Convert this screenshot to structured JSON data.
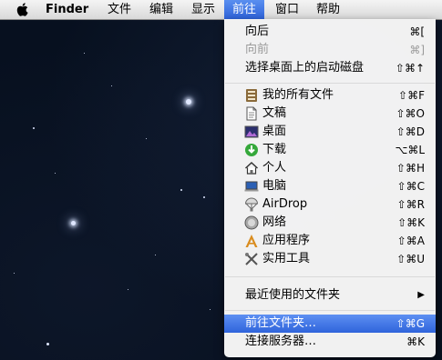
{
  "menubar": {
    "app_name": "Finder",
    "items": [
      "文件",
      "编辑",
      "显示",
      "前往",
      "窗口",
      "帮助"
    ]
  },
  "go_menu": {
    "back": {
      "label": "向后",
      "shortcut": "⌘["
    },
    "forward": {
      "label": "向前",
      "shortcut": "⌘]"
    },
    "enclosing": {
      "label": "选择桌面上的启动磁盘",
      "shortcut": "⇧⌘↑"
    },
    "places": [
      {
        "label": "我的所有文件",
        "shortcut": "⇧⌘F",
        "icon": "all-files-icon"
      },
      {
        "label": "文稿",
        "shortcut": "⇧⌘O",
        "icon": "document-icon"
      },
      {
        "label": "桌面",
        "shortcut": "⇧⌘D",
        "icon": "desktop-icon"
      },
      {
        "label": "下载",
        "shortcut": "⌥⌘L",
        "icon": "download-icon"
      },
      {
        "label": "个人",
        "shortcut": "⇧⌘H",
        "icon": "home-icon"
      },
      {
        "label": "电脑",
        "shortcut": "⇧⌘C",
        "icon": "computer-icon"
      },
      {
        "label": "AirDrop",
        "shortcut": "⇧⌘R",
        "icon": "airdrop-icon"
      },
      {
        "label": "网络",
        "shortcut": "⇧⌘K",
        "icon": "network-icon"
      },
      {
        "label": "应用程序",
        "shortcut": "⇧⌘A",
        "icon": "applications-icon"
      },
      {
        "label": "实用工具",
        "shortcut": "⇧⌘U",
        "icon": "utilities-icon"
      }
    ],
    "recent_folders": {
      "label": "最近使用的文件夹"
    },
    "go_to_folder": {
      "label": "前往文件夹…",
      "shortcut": "⇧⌘G"
    },
    "connect_server": {
      "label": "连接服务器…",
      "shortcut": "⌘K"
    }
  },
  "colors": {
    "highlight": "#2f64db",
    "menubar": "#e6e6e6",
    "desktop": "#07101f"
  }
}
